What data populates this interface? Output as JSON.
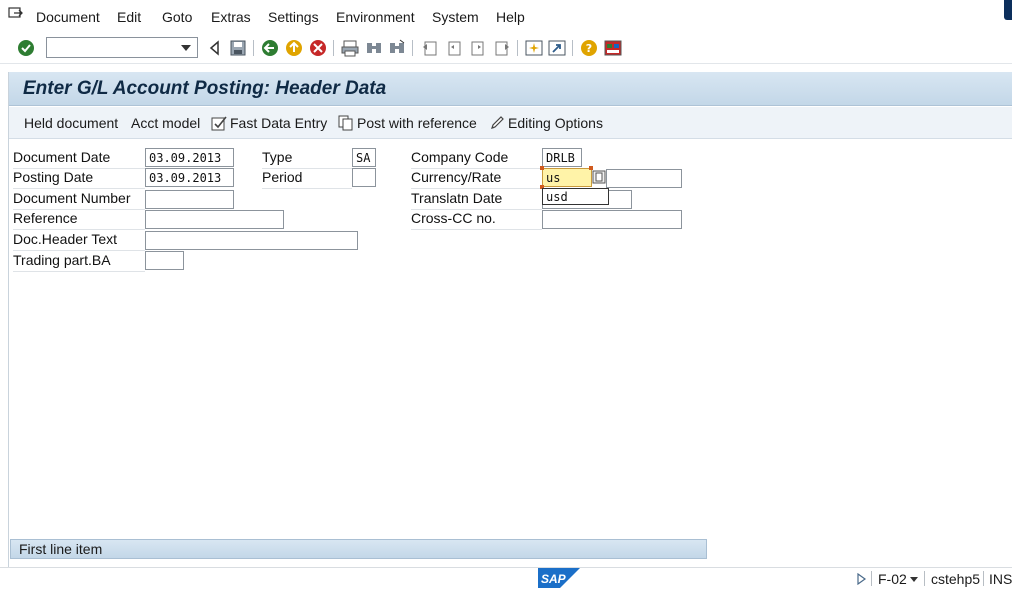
{
  "menu": {
    "items": [
      {
        "label": "Document",
        "key": "D"
      },
      {
        "label": "Edit",
        "key": "E"
      },
      {
        "label": "Goto",
        "key": "G"
      },
      {
        "label": "Extras",
        "key": ""
      },
      {
        "label": "Settings",
        "key": "S"
      },
      {
        "label": "Environment",
        "key": "v"
      },
      {
        "label": "System",
        "key": "y"
      },
      {
        "label": "Help",
        "key": "H"
      }
    ]
  },
  "toolbar": {
    "command_field_value": "",
    "icons": [
      "enter-icon",
      "command-dropdown-icon",
      "back-triangle-icon",
      "save-icon",
      "back-icon",
      "exit-icon",
      "cancel-icon",
      "print-icon",
      "find-icon",
      "find-next-icon",
      "first-page-icon",
      "previous-page-icon",
      "next-page-icon",
      "last-page-icon",
      "new-session-icon",
      "shortcut-icon",
      "help-icon",
      "layout-icon"
    ]
  },
  "page": {
    "title": "Enter G/L Account Posting: Header Data"
  },
  "app_toolbar": {
    "held_document": "Held document",
    "acct_model": "Acct model",
    "fast_data_entry": "Fast Data Entry",
    "post_with_reference": "Post with reference",
    "editing_options": "Editing Options"
  },
  "form": {
    "document_date": {
      "label": "Document Date",
      "value": "03.09.2013"
    },
    "posting_date": {
      "label": "Posting Date",
      "value": "03.09.2013"
    },
    "document_number": {
      "label": "Document Number",
      "value": ""
    },
    "reference": {
      "label": "Reference",
      "value": ""
    },
    "doc_header_text": {
      "label": "Doc.Header Text",
      "value": ""
    },
    "trading_part_ba": {
      "label": "Trading part.BA",
      "value": ""
    },
    "type": {
      "label": "Type",
      "value": "SA"
    },
    "period": {
      "label": "Period",
      "value": ""
    },
    "company_code": {
      "label": "Company Code",
      "value": "DRLB"
    },
    "currency_rate": {
      "label": "Currency/Rate",
      "value": "us",
      "rate_value": ""
    },
    "translatn_date": {
      "label": "Translatn Date",
      "value": "",
      "autocomplete": "usd"
    },
    "cross_cc_no": {
      "label": "Cross-CC no.",
      "value": ""
    }
  },
  "first_line_item": {
    "label": "First line item"
  },
  "status_bar": {
    "transaction": "F-02",
    "system": "cstehp5",
    "mode": "INS"
  },
  "colors": {
    "title_bar": "#c3d7e8",
    "title_text": "#0f2a45",
    "focus_field": "#fff3a8"
  }
}
